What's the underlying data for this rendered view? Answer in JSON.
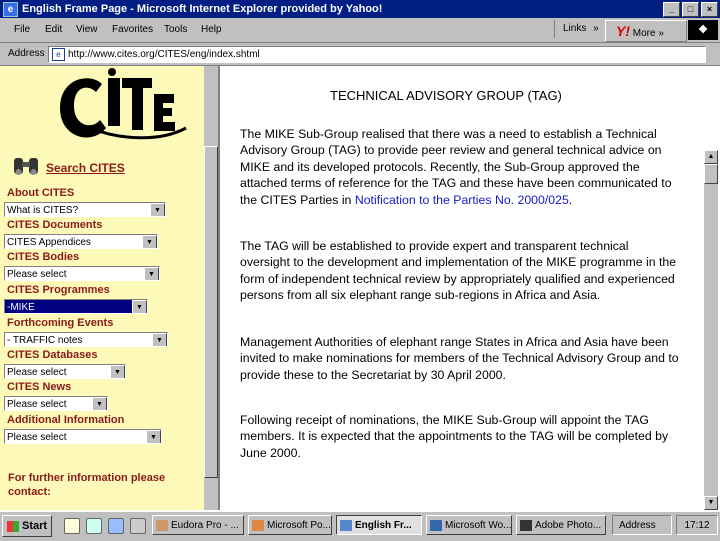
{
  "window": {
    "title": "English Frame Page - Microsoft Internet Explorer provided by Yahoo!"
  },
  "menubar": {
    "items": [
      "File",
      "Edit",
      "View",
      "Favorites",
      "Tools",
      "Help"
    ],
    "links_label": "Links",
    "yahoo_label": "More »",
    "yahoo_logo": "Y!"
  },
  "address": {
    "label": "Address",
    "url": "http://www.cites.org/CITES/eng/index.shtml"
  },
  "sidebar": {
    "logo_text": "CITES",
    "search_label": "Search CITES",
    "sections": [
      {
        "title": "About CITES",
        "select_value": "What is CITES?"
      },
      {
        "title": "CITES Documents",
        "select_value": "CITES Appendices"
      },
      {
        "title": "CITES Bodies",
        "select_value": "Please select"
      },
      {
        "title": "CITES Programmes",
        "select_value": "-MIKE"
      },
      {
        "title": "Forthcoming Events",
        "select_value": "- TRAFFIC notes"
      },
      {
        "title": "CITES Databases",
        "select_value": "Please select"
      },
      {
        "title": "CITES News",
        "select_value": "Please select"
      },
      {
        "title": "Additional Information",
        "select_value": "Please select"
      }
    ],
    "further_info": "For further information please contact:"
  },
  "content": {
    "heading": "TECHNICAL ADVISORY GROUP (TAG)",
    "para1_text": "The MIKE Sub-Group realised that there was a need to establish a Technical Advisory Group (TAG) to provide peer review and general technical advice on MIKE and its developed protocols. Recently, the Sub-Group approved the attached terms of reference for the TAG and these have been communicated to the CITES Parties in",
    "para1_link": "Notification to the Parties No. 2000/025",
    "para1_end": ".",
    "para2": "The TAG will be established to provide expert and transparent technical oversight to the development and implementation of the MIKE programme in the form of independent technical review by appropriately qualified and experienced persons from all six elephant range sub-regions in Africa and Asia.",
    "para3": "Management Authorities of elephant range States in Africa and Asia have been invited to make nominations for members of the Technical Advisory Group and to provide these to the Secretariat by 30 April 2000.",
    "para4": "Following receipt of nominations, the MIKE Sub-Group will appoint the TAG members. It is expected that the appointments to the TAG will be completed by June 2000."
  },
  "taskbar": {
    "start_label": "Start",
    "tasks": [
      "Eudora Pro - ...",
      "Microsoft Po...",
      "English Fr...",
      "Microsoft Wo...",
      "Adobe Photo..."
    ],
    "tray_address": "Address",
    "clock": "17:12"
  }
}
